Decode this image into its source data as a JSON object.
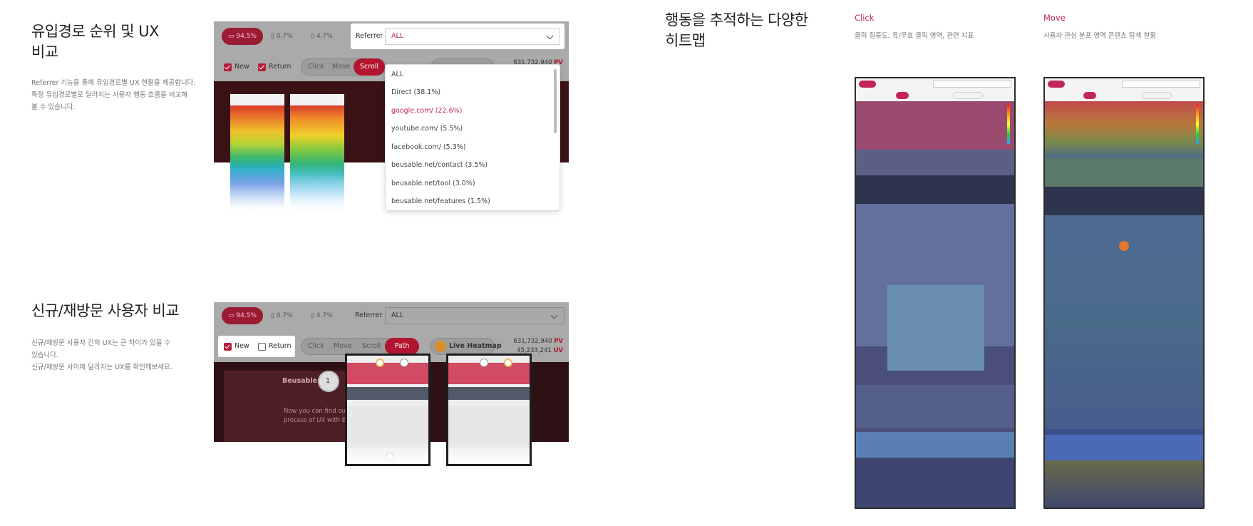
{
  "section1": {
    "title_line1": "유입경로 순위 및 UX",
    "title_line2": "비교",
    "desc_lines": [
      "Referrer 기능을 통해 유입경로별 UX 현황을 제공합니다.",
      "특정 유입경로별로 달라지는 사용자 행동 흐름을 비교해",
      "볼 수 있습니다."
    ]
  },
  "section2": {
    "title": "신규/재방문 사용자 비교",
    "desc_lines": [
      "신규/재방문 사용자 간의 UX는 큰 차이가 있을 수",
      "있습니다.",
      "신규/재방문 사이에 달라지는 UX를 확인해보세요."
    ]
  },
  "section3": {
    "title_line1": "행동을 추적하는 다양한",
    "title_line2": "히트맵"
  },
  "columns": {
    "click": {
      "title": "Click",
      "desc": "클릭 집중도, 유/무효 클릭 영역, 관련 지표"
    },
    "move": {
      "title": "Move",
      "desc": "사용자 관심 분포 영역 콘텐츠 탐색 현황"
    }
  },
  "toolbar": {
    "desktop_pct": "94.5%",
    "tablet_pct": "0.7%",
    "mobile_pct": "4.7%",
    "referrer_label": "Referrer",
    "referrer_value": "ALL",
    "new_label": "New",
    "return_label": "Return",
    "tabs": [
      "Click",
      "Move",
      "Scroll",
      "Path"
    ],
    "live_heatmap": "Live Heatmap",
    "pv_count": "631,732,940",
    "pv_unit": "PV",
    "uv_count": "45,233,241",
    "uv_unit": "UV",
    "mini_pv": "631,732,940",
    "mini_uv": "45,233,241"
  },
  "referrer_options": [
    "ALL",
    "Direct (38.1%)",
    "google.com/ (22.6%)",
    "youtube.com/ (5.5%)",
    "facebook.com/ (5.3%)",
    "beusable.net/contact (3.5%)",
    "beusable.net/tool (3.0%)",
    "beusable.net/features (1.5%)"
  ],
  "path_mock": {
    "brand": "Beusable",
    "step_number": "1",
    "copy_line1": "Now you can find out the",
    "copy_line2": "process of UX with Beus"
  },
  "colors": {
    "accent": "#c2255c",
    "brand_red": "#b31530"
  }
}
